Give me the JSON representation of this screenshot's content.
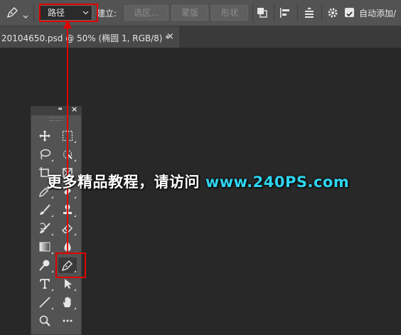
{
  "options_bar": {
    "path_mode": "路径",
    "make_label": "建立:",
    "selection_btn": "选区...",
    "mask_btn": "蒙版",
    "shape_btn": "形状",
    "auto_add_label": "自动添加/",
    "auto_add_checked": true
  },
  "document_tab": {
    "title": "20104650.psd @ 50% (椭圆 1, RGB/8) *",
    "close": "×"
  },
  "toolbar": {
    "collapse_glyph": "◂◂",
    "close_glyph": "×"
  },
  "watermark": {
    "text": "更多精品教程，请访问",
    "site": "www.240PS.com"
  },
  "colors": {
    "annotation_red": "#e00000",
    "watermark_cyan": "#2fd5f0"
  }
}
